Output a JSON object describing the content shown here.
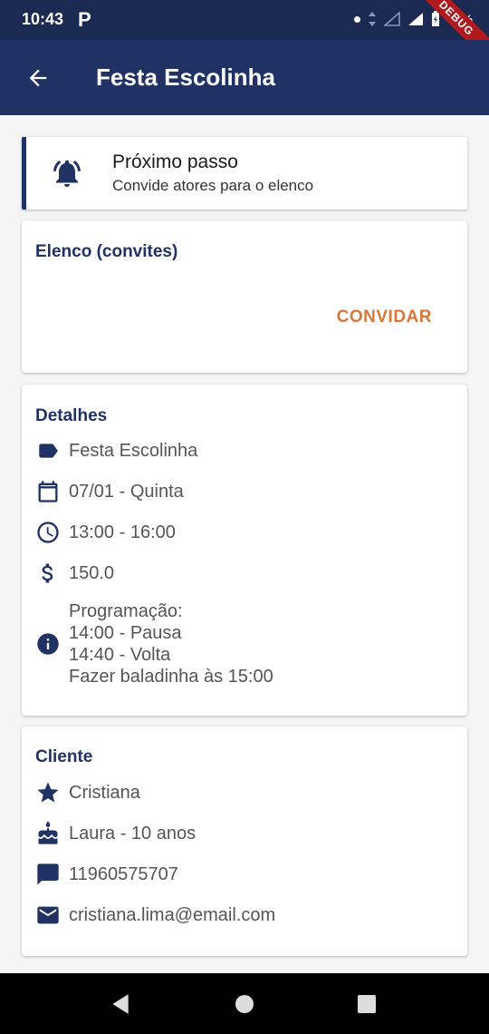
{
  "status_bar": {
    "time": "10:43",
    "app_icon": "P",
    "battery": "75%",
    "debug": "DEBUG"
  },
  "app_bar": {
    "title": "Festa Escolinha",
    "back_icon": "arrow-back-icon"
  },
  "next_step": {
    "icon": "bell-icon",
    "title": "Próximo passo",
    "subtitle": "Convide atores para o elenco"
  },
  "cast": {
    "title": "Elenco (convites)",
    "invite_label": "CONVIDAR"
  },
  "details": {
    "title": "Detalhes",
    "name": "Festa Escolinha",
    "date": "07/01 - Quinta",
    "time": "13:00 - 16:00",
    "price": "150.0",
    "program": [
      "Programação:",
      "14:00 - Pausa",
      "14:40 - Volta",
      "Fazer baladinha às 15:00"
    ]
  },
  "client": {
    "title": "Cliente",
    "name": "Cristiana",
    "child": "Laura - 10 anos",
    "phone": "11960575707",
    "email": "cristiana.lima@email.com"
  },
  "colors": {
    "primary": "#1f3263",
    "status_bar": "#1b2a52",
    "accent": "#d8773a",
    "background": "#f5f5f5"
  }
}
